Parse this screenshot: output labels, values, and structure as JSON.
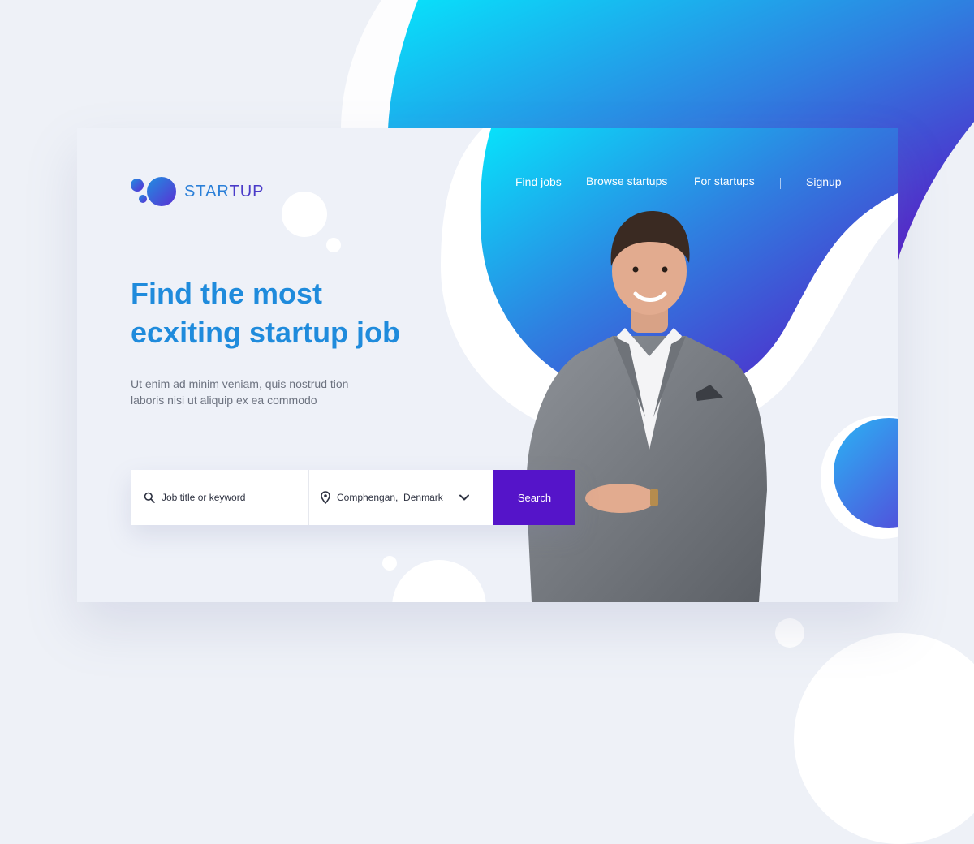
{
  "brand": {
    "name_part1": "STAR",
    "name_part2": "TUP",
    "logo_icon": "bubbles-logo-icon"
  },
  "nav": {
    "items": [
      {
        "label": "Find jobs"
      },
      {
        "label": "Browse startups"
      },
      {
        "label": "For startups"
      }
    ],
    "signup_label": "Signup"
  },
  "hero": {
    "headline_line1": "Find the most",
    "headline_line2": "ecxiting startup job",
    "subtext_line1": "Ut enim ad minim veniam, quis nostrud tion",
    "subtext_line2": "laboris nisi ut aliquip ex ea commodo"
  },
  "search": {
    "keyword_placeholder": "Job title or keyword",
    "location_value": "Comphengan,  Denmark",
    "button_label": "Search",
    "search_icon": "search-icon",
    "location_icon": "location-pin-icon",
    "dropdown_icon": "chevron-down-icon"
  },
  "colors": {
    "accent_purple": "#5514c9",
    "headline_blue": "#1f8bdc",
    "gradient_start": "#07e3fb",
    "gradient_end": "#5a10c4",
    "background": "#eef1f7"
  }
}
